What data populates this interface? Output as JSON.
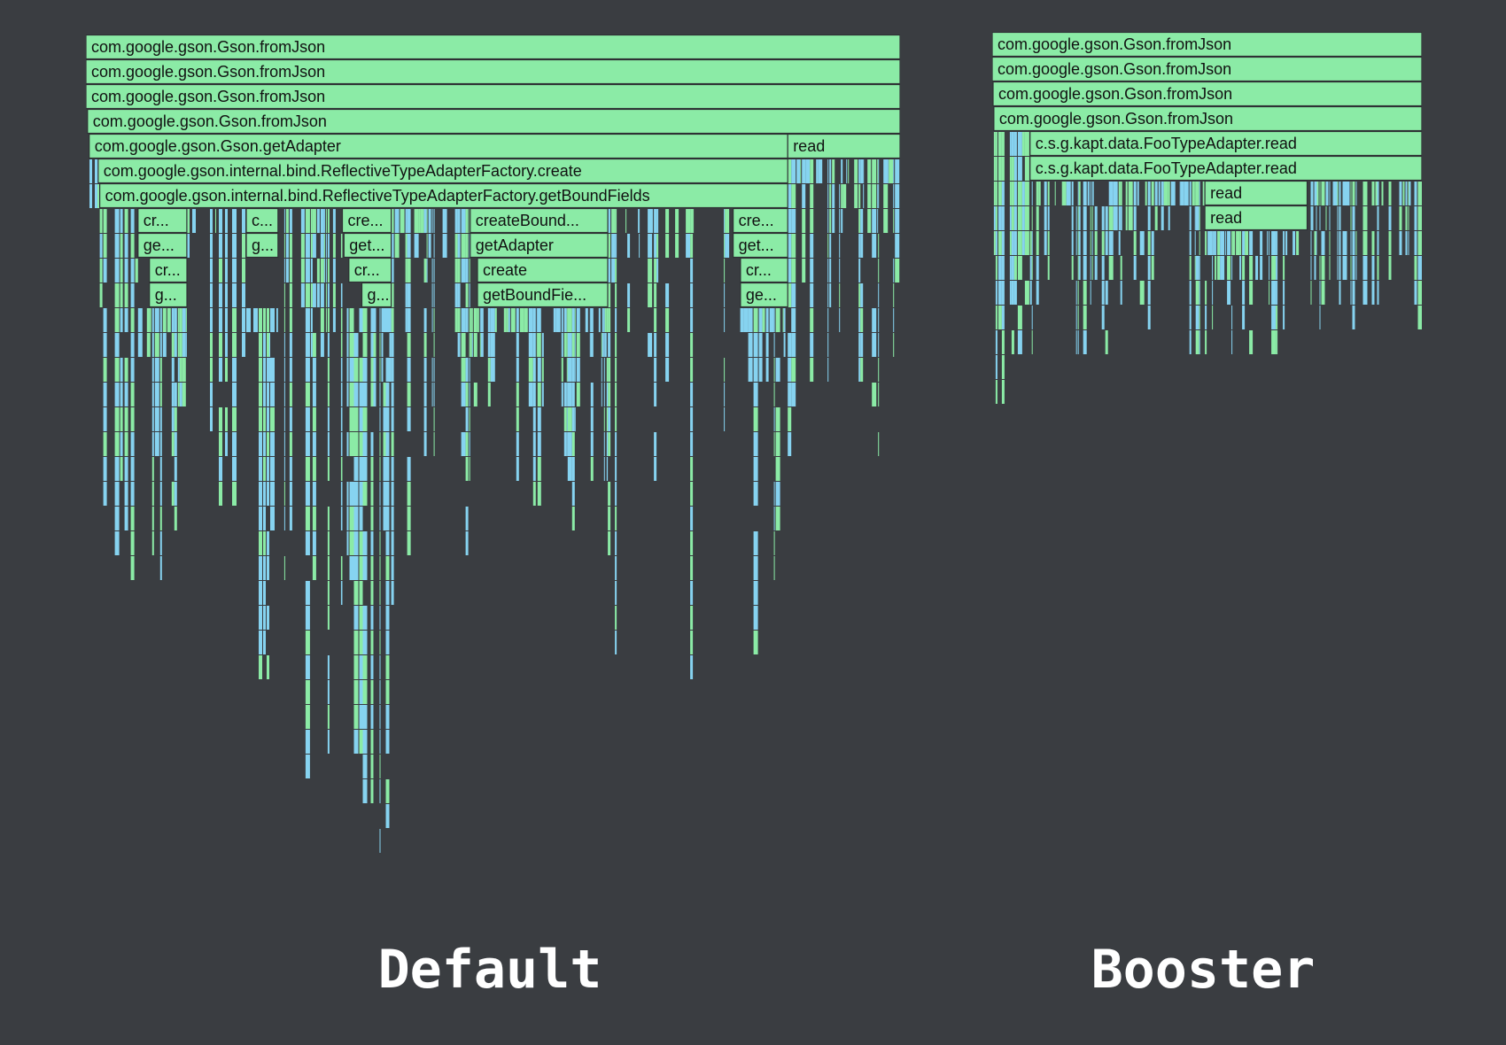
{
  "colors": {
    "background": "#3a3d41",
    "frame_green": "#8beba6",
    "frame_blue": "#86d3f0",
    "frame_border": "#2e3134",
    "label_text": "#111111",
    "caption_text": "#ffffff"
  },
  "default_panel": {
    "caption": "Default",
    "labeled_frames": [
      {
        "label": "com.google.gson.Gson.fromJson",
        "depth": 0,
        "start": 0.0,
        "end": 1.0
      },
      {
        "label": "com.google.gson.Gson.fromJson",
        "depth": 1,
        "start": 0.0,
        "end": 1.0
      },
      {
        "label": "com.google.gson.Gson.fromJson",
        "depth": 2,
        "start": 0.0,
        "end": 1.0
      },
      {
        "label": "com.google.gson.Gson.fromJson",
        "depth": 3,
        "start": 0.002,
        "end": 1.0
      },
      {
        "label": "com.google.gson.Gson.getAdapter",
        "depth": 4,
        "start": 0.004,
        "end": 0.862
      },
      {
        "label": "read",
        "depth": 4,
        "start": 0.862,
        "end": 1.0
      },
      {
        "label": "com.google.gson.internal.bind.ReflectiveTypeAdapterFactory.create",
        "depth": 5,
        "start": 0.015,
        "end": 0.862
      },
      {
        "label": "com.google.gson.internal.bind.ReflectiveTypeAdapterFactory.getBoundFields",
        "depth": 6,
        "start": 0.017,
        "end": 0.862
      },
      {
        "label": "cr...",
        "depth": 7,
        "start": 0.064,
        "end": 0.124
      },
      {
        "label": "c...",
        "depth": 7,
        "start": 0.197,
        "end": 0.236
      },
      {
        "label": "cre...",
        "depth": 7,
        "start": 0.315,
        "end": 0.375
      },
      {
        "label": "createBound...",
        "depth": 7,
        "start": 0.472,
        "end": 0.641
      },
      {
        "label": "cre...",
        "depth": 7,
        "start": 0.795,
        "end": 0.862
      },
      {
        "label": "ge...",
        "depth": 8,
        "start": 0.064,
        "end": 0.124
      },
      {
        "label": "g...",
        "depth": 8,
        "start": 0.197,
        "end": 0.236
      },
      {
        "label": "get...",
        "depth": 8,
        "start": 0.317,
        "end": 0.375
      },
      {
        "label": "getAdapter",
        "depth": 8,
        "start": 0.472,
        "end": 0.641
      },
      {
        "label": "get...",
        "depth": 8,
        "start": 0.795,
        "end": 0.862
      },
      {
        "label": "cr...",
        "depth": 9,
        "start": 0.078,
        "end": 0.124
      },
      {
        "label": "cr...",
        "depth": 9,
        "start": 0.323,
        "end": 0.375
      },
      {
        "label": "create",
        "depth": 9,
        "start": 0.481,
        "end": 0.641
      },
      {
        "label": "cr...",
        "depth": 9,
        "start": 0.804,
        "end": 0.862
      },
      {
        "label": "g...",
        "depth": 10,
        "start": 0.078,
        "end": 0.124
      },
      {
        "label": "g...",
        "depth": 10,
        "start": 0.339,
        "end": 0.375
      },
      {
        "label": "getBoundFie...",
        "depth": 10,
        "start": 0.481,
        "end": 0.641
      },
      {
        "label": "ge...",
        "depth": 10,
        "start": 0.804,
        "end": 0.862
      }
    ]
  },
  "booster_panel": {
    "caption": "Booster",
    "labeled_frames": [
      {
        "label": "com.google.gson.Gson.fromJson",
        "depth": 0,
        "start": 0.0,
        "end": 1.0
      },
      {
        "label": "com.google.gson.Gson.fromJson",
        "depth": 1,
        "start": 0.0,
        "end": 1.0
      },
      {
        "label": "com.google.gson.Gson.fromJson",
        "depth": 2,
        "start": 0.002,
        "end": 1.0
      },
      {
        "label": "com.google.gson.Gson.fromJson",
        "depth": 3,
        "start": 0.004,
        "end": 1.0
      },
      {
        "label": "c.s.g.kapt.data.FooTypeAdapter.read",
        "depth": 4,
        "start": 0.088,
        "end": 1.0
      },
      {
        "label": "c.s.g.kapt.data.FooTypeAdapter.read",
        "depth": 5,
        "start": 0.088,
        "end": 1.0
      },
      {
        "label": "read",
        "depth": 6,
        "start": 0.495,
        "end": 0.733
      },
      {
        "label": "read",
        "depth": 7,
        "start": 0.495,
        "end": 0.733
      }
    ]
  }
}
